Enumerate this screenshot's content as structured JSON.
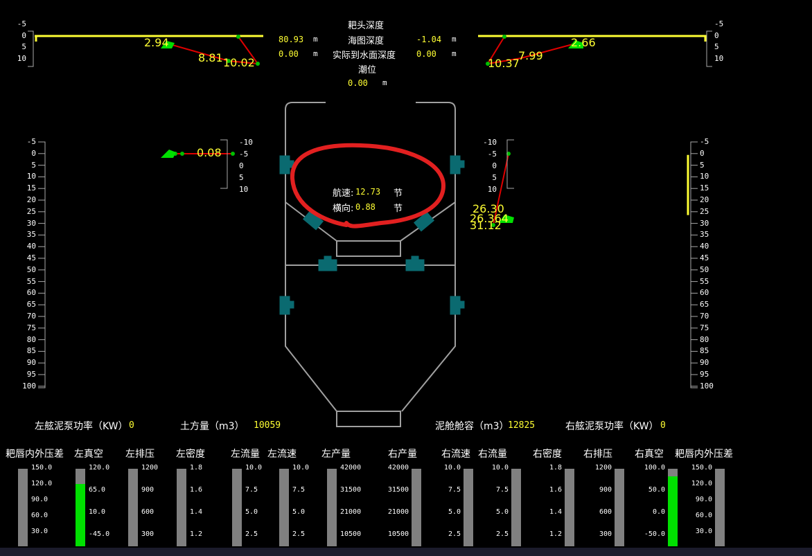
{
  "top": {
    "title_drag_depth": "耙头深度",
    "label_chart_depth": "海图深度",
    "label_actual_depth": "实际到水面深度",
    "label_tide": "潮位",
    "left_drag_depth": "80.93",
    "left_chart_depth": "0.00",
    "right_drag_depth": "-1.04",
    "right_chart_depth": "0.00",
    "tide": "0.00",
    "unit_m": "m"
  },
  "left_arm": {
    "v1": "2.94",
    "v2": "8.81",
    "v3": "10.02",
    "side": "0.08"
  },
  "right_arm": {
    "v1": "10.37",
    "v2": "7.99",
    "v3": "2.66",
    "side_a": "26.30",
    "side_b": "26.364",
    "side_c": "31.12"
  },
  "small_scale_top": [
    "-5",
    "0",
    "5",
    "10"
  ],
  "small_scale_mid": [
    "-10",
    "-5",
    "0",
    "5",
    "10"
  ],
  "side_scale": [
    "-5",
    "0",
    "5",
    "10",
    "15",
    "20",
    "25",
    "30",
    "35",
    "40",
    "45",
    "50",
    "55",
    "60",
    "65",
    "70",
    "75",
    "80",
    "85",
    "90",
    "95",
    "100"
  ],
  "right_side_level": 30,
  "center": {
    "speed_label": "航速:",
    "speed_value": "12.73",
    "lateral_label": "横向:",
    "lateral_value": "0.88",
    "unit_knot": "节"
  },
  "summary": {
    "left_pump_label": "左舷泥泵功率（KW）",
    "left_pump_value": "0",
    "earth_label": "土方量（m3）",
    "earth_value": "10059",
    "hopper_label": "泥舱舱容（m3）",
    "hopper_value": "12825",
    "right_pump_label": "右舷泥泵功率（KW）",
    "right_pump_value": "0"
  },
  "gauges": [
    {
      "label": "耙唇内外压差",
      "ticks": [
        "150.0",
        "120.0",
        "90.0",
        "60.0",
        "30.0"
      ],
      "fill": 0
    },
    {
      "label": "左真空",
      "ticks": [
        "120.0",
        "65.0",
        "10.0",
        "-45.0"
      ],
      "fill": 0.8
    },
    {
      "label": "左排压",
      "ticks": [
        "1200",
        "900",
        "600",
        "300"
      ],
      "fill": 0
    },
    {
      "label": "左密度",
      "ticks": [
        "1.8",
        "1.6",
        "1.4",
        "1.2"
      ],
      "fill": 0
    },
    {
      "label": "左流量",
      "ticks": [
        "10.0",
        "7.5",
        "5.0",
        "2.5"
      ],
      "fill": 0
    },
    {
      "label": "左流速",
      "ticks": [
        "10.0",
        "7.5",
        "5.0",
        "2.5"
      ],
      "fill": 0
    },
    {
      "label": "左产量",
      "ticks": [
        "42000",
        "31500",
        "21000",
        "10500"
      ],
      "fill": 0
    },
    {
      "label": "右产量",
      "ticks": [
        "42000",
        "31500",
        "21000",
        "10500"
      ],
      "fill": 0
    },
    {
      "label": "右流速",
      "ticks": [
        "10.0",
        "7.5",
        "5.0",
        "2.5"
      ],
      "fill": 0
    },
    {
      "label": "右流量",
      "ticks": [
        "10.0",
        "7.5",
        "5.0",
        "2.5"
      ],
      "fill": 0
    },
    {
      "label": "右密度",
      "ticks": [
        "1.8",
        "1.6",
        "1.4",
        "1.2"
      ],
      "fill": 0
    },
    {
      "label": "右排压",
      "ticks": [
        "1200",
        "900",
        "600",
        "300"
      ],
      "fill": 0
    },
    {
      "label": "右真空",
      "ticks": [
        "100.0",
        "50.0",
        "0.0",
        "-50.0"
      ],
      "fill": 0.9
    },
    {
      "label": "耙唇内外压差",
      "ticks": [
        "150.0",
        "120.0",
        "90.0",
        "60.0",
        "30.0"
      ],
      "fill": 0
    }
  ]
}
